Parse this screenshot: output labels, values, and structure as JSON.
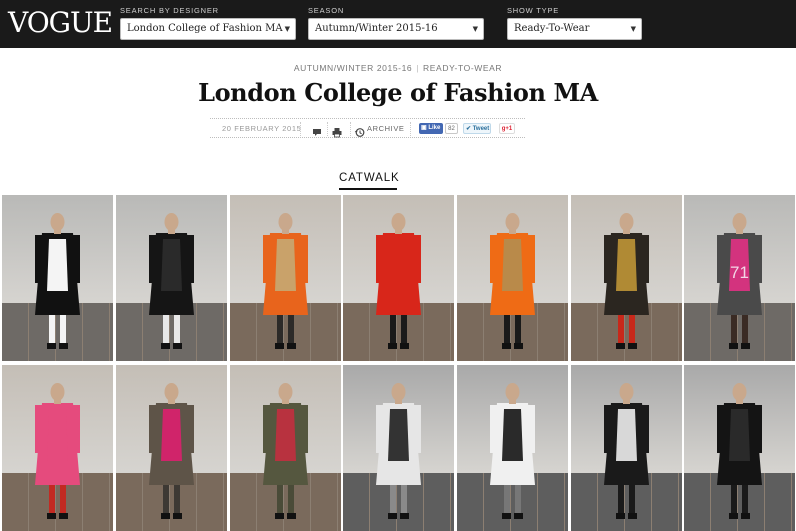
{
  "brand": {
    "logo_text": "VOGUE"
  },
  "filters": {
    "designer": {
      "label": "SEARCH BY DESIGNER",
      "value": "London College of Fashion MA"
    },
    "season": {
      "label": "SEASON",
      "value": "Autumn/Winter 2015-16"
    },
    "show_type": {
      "label": "SHOW TYPE",
      "value": "Ready-To-Wear"
    }
  },
  "show": {
    "season": "AUTUMN/WINTER 2015-16",
    "type": "READY-TO-WEAR",
    "title": "London College of Fashion MA",
    "date": "20 FEBRUARY 2015",
    "archive_label": "ARCHIVE",
    "like_label": "Like",
    "like_count": "82",
    "tweet_label": "Tweet",
    "gplus_label": "g+1"
  },
  "section": {
    "label": "CATWALK"
  },
  "icons": {
    "comment": "comment-icon",
    "print": "print-icon",
    "archive": "archive-icon",
    "select_arrow": "chevron-down-icon"
  },
  "colors": {
    "topbar": "#1a1a1a",
    "facebook": "#4267b2",
    "twitter": "#2a6f9c",
    "gplus": "#dd2233"
  },
  "looks": [
    {
      "outfit": "black and white block-color tunic, white trousers, white bucket hat",
      "tone": "grey",
      "number": ""
    },
    {
      "outfit": "all-black long coat, white headwrap",
      "tone": "grey",
      "number": ""
    },
    {
      "outfit": "orange long coat over printed dress",
      "tone": "warm",
      "number": ""
    },
    {
      "outfit": "red coat with gold chain detailing",
      "tone": "warm",
      "number": ""
    },
    {
      "outfit": "orange jacket, printed pencil skirt",
      "tone": "warm",
      "number": ""
    },
    {
      "outfit": "black and gold maxi dress, red wrap",
      "tone": "warm",
      "number": ""
    },
    {
      "outfit": "grey jacket, magenta skirt printed 71",
      "tone": "grey",
      "number": "71"
    },
    {
      "outfit": "pink dress with red cord detail",
      "tone": "warm",
      "number": ""
    },
    {
      "outfit": "printed top, pink top, grey trousers",
      "tone": "warm",
      "number": ""
    },
    {
      "outfit": "long olive coat, red trousers",
      "tone": "warm",
      "number": ""
    },
    {
      "outfit": "patchwork coat, black and white",
      "tone": "mono",
      "number": ""
    },
    {
      "outfit": "patchwork shirt dress, boots",
      "tone": "mono",
      "number": ""
    },
    {
      "outfit": "black patchwork top, black skirt",
      "tone": "mono",
      "number": ""
    },
    {
      "outfit": "black jacket, black trousers",
      "tone": "mono",
      "number": ""
    }
  ]
}
